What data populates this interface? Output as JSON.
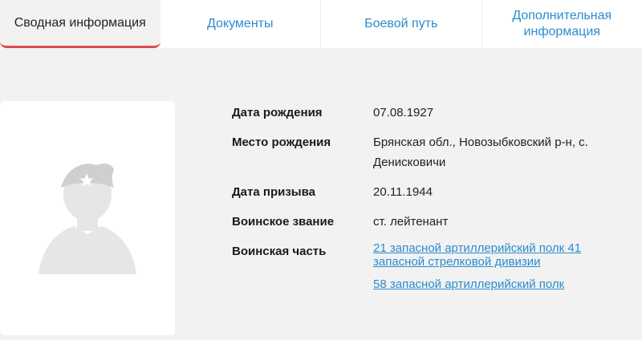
{
  "tabs": [
    {
      "label": "Сводная информация",
      "active": true
    },
    {
      "label": "Документы",
      "active": false
    },
    {
      "label": "Боевой путь",
      "active": false
    },
    {
      "label": "Дополнительная информация",
      "active": false
    }
  ],
  "colors": {
    "accent": "#e04a4a",
    "link": "#2a8ccf",
    "background": "#f2f2f2"
  },
  "photo": {
    "icon": "soldier-silhouette-icon"
  },
  "details": {
    "birth_date": {
      "label": "Дата рождения",
      "value": "07.08.1927"
    },
    "birth_place": {
      "label": "Место рождения",
      "value": "Брянская обл., Новозыбковский р-н, с. Денисковичи"
    },
    "draft_date": {
      "label": "Дата призыва",
      "value": "20.11.1944"
    },
    "rank": {
      "label": "Воинское звание",
      "value": "ст. лейтенант"
    },
    "unit": {
      "label": "Воинская часть",
      "links": [
        "21 запасной артиллерийский полк 41 запасной стрелковой дивизии",
        "58 запасной артиллерийский полк"
      ]
    }
  }
}
